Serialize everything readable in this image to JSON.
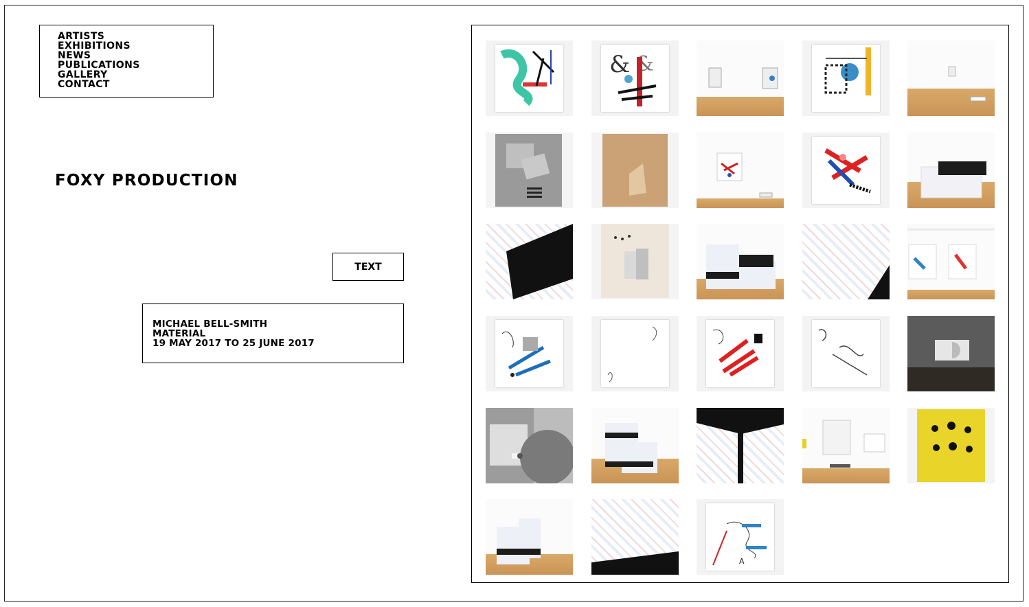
{
  "nav": {
    "items": [
      "ARTISTS",
      "EXHIBITIONS",
      "NEWS",
      "PUBLICATIONS",
      "GALLERY",
      "CONTACT"
    ]
  },
  "brand": "FOXY PRODUCTION",
  "text_button": "TEXT",
  "exhibition": {
    "artist": "MICHAEL BELL-SMITH",
    "title": "MATERIAL",
    "dates": "19 MAY 2017 TO 25 JUNE 2017"
  },
  "thumbnails": [
    "artwork-teal",
    "artwork-ampersand",
    "installation-view",
    "artwork-yellow-blue",
    "installation-view",
    "artwork-gray",
    "artwork-tan",
    "installation-view",
    "artwork-red-blue",
    "sculpture-box",
    "sculpture-detail",
    "artwork-beige",
    "sculpture-box",
    "sculpture-detail",
    "installation-view",
    "artwork-blue",
    "artwork-white",
    "artwork-red",
    "artwork-white",
    "installation-dark",
    "artwork-gray-circle",
    "sculpture-box",
    "sculpture-detail",
    "installation-view",
    "artwork-yellow",
    "sculpture-box",
    "sculpture-detail",
    "artwork-line"
  ]
}
